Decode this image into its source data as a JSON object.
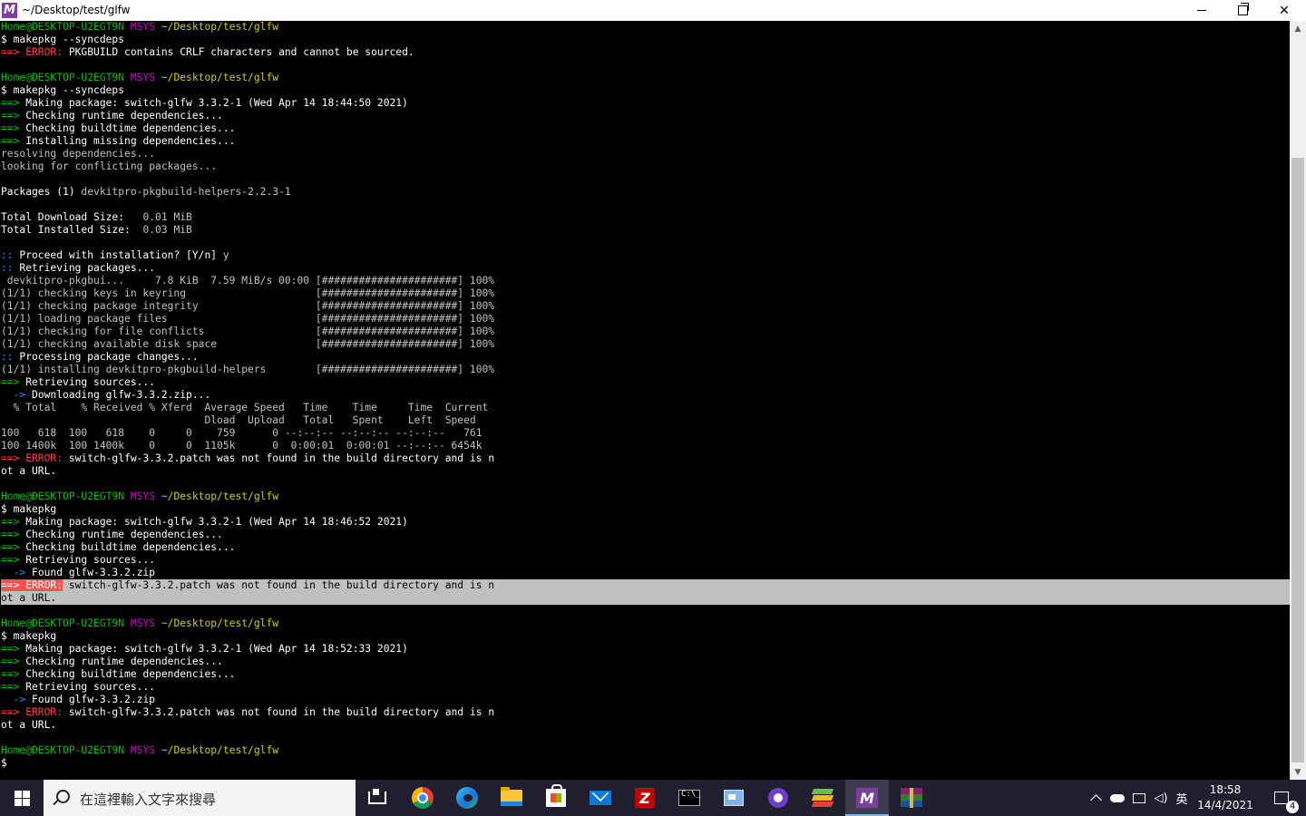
{
  "window": {
    "title": "~/Desktop/test/glfw",
    "app_icon_letter": "M",
    "minimize_icon": "minimize-icon",
    "maximize_icon": "restore-icon",
    "close_symbol": "✕"
  },
  "terminal": {
    "lines": [
      {
        "segs": [
          {
            "t": "Home@DESKTOP-U2EGT9N ",
            "c": "g"
          },
          {
            "t": "MSYS ",
            "c": "m"
          },
          {
            "t": "~/Desktop/test/glfw",
            "c": "y"
          }
        ]
      },
      {
        "segs": [
          {
            "t": "$ makepkg --syncdeps",
            "c": "w"
          }
        ]
      },
      {
        "segs": [
          {
            "t": "==> ERROR: ",
            "c": "r"
          },
          {
            "t": "PKGBUILD contains CRLF characters and cannot be sourced.",
            "c": "w"
          }
        ]
      },
      {
        "segs": []
      },
      {
        "segs": [
          {
            "t": "Home@DESKTOP-U2EGT9N ",
            "c": "g"
          },
          {
            "t": "MSYS ",
            "c": "m"
          },
          {
            "t": "~/Desktop/test/glfw",
            "c": "y"
          }
        ]
      },
      {
        "segs": [
          {
            "t": "$ makepkg --syncdeps",
            "c": "w"
          }
        ]
      },
      {
        "segs": [
          {
            "t": "==> ",
            "c": "g"
          },
          {
            "t": "Making package: switch-glfw 3.3.2-1 (Wed Apr 14 18:44:50 2021)",
            "c": "w"
          }
        ]
      },
      {
        "segs": [
          {
            "t": "==> ",
            "c": "g"
          },
          {
            "t": "Checking runtime dependencies...",
            "c": "w"
          }
        ]
      },
      {
        "segs": [
          {
            "t": "==> ",
            "c": "g"
          },
          {
            "t": "Checking buildtime dependencies...",
            "c": "w"
          }
        ]
      },
      {
        "segs": [
          {
            "t": "==> ",
            "c": "g"
          },
          {
            "t": "Installing missing dependencies...",
            "c": "w"
          }
        ]
      },
      {
        "segs": [
          {
            "t": "resolving dependencies...",
            "c": "p"
          }
        ]
      },
      {
        "segs": [
          {
            "t": "looking for conflicting packages...",
            "c": "p"
          }
        ]
      },
      {
        "segs": []
      },
      {
        "segs": [
          {
            "t": "Packages (1) ",
            "c": "w"
          },
          {
            "t": "devkitpro-pkgbuild-helpers-2.2.3-1",
            "c": "p"
          }
        ]
      },
      {
        "segs": []
      },
      {
        "segs": [
          {
            "t": "Total Download Size:  ",
            "c": "w"
          },
          {
            "t": " 0.01 MiB",
            "c": "p"
          }
        ]
      },
      {
        "segs": [
          {
            "t": "Total Installed Size: ",
            "c": "w"
          },
          {
            "t": " 0.03 MiB",
            "c": "p"
          }
        ]
      },
      {
        "segs": []
      },
      {
        "segs": [
          {
            "t": ":: ",
            "c": "b"
          },
          {
            "t": "Proceed with installation? [Y/n] ",
            "c": "w"
          },
          {
            "t": "y",
            "c": "p"
          }
        ]
      },
      {
        "segs": [
          {
            "t": ":: ",
            "c": "b"
          },
          {
            "t": "Retrieving packages...",
            "c": "w"
          }
        ]
      },
      {
        "segs": [
          {
            "t": " devkitpro-pkgbui...     7.8 KiB  7.59 MiB/s 00:00 [######################] 100%",
            "c": "p"
          }
        ]
      },
      {
        "segs": [
          {
            "t": "(1/1) checking keys in keyring                     [######################] 100%",
            "c": "p"
          }
        ]
      },
      {
        "segs": [
          {
            "t": "(1/1) checking package integrity                   [######################] 100%",
            "c": "p"
          }
        ]
      },
      {
        "segs": [
          {
            "t": "(1/1) loading package files                        [######################] 100%",
            "c": "p"
          }
        ]
      },
      {
        "segs": [
          {
            "t": "(1/1) checking for file conflicts                  [######################] 100%",
            "c": "p"
          }
        ]
      },
      {
        "segs": [
          {
            "t": "(1/1) checking available disk space                [######################] 100%",
            "c": "p"
          }
        ]
      },
      {
        "segs": [
          {
            "t": ":: ",
            "c": "b"
          },
          {
            "t": "Processing package changes...",
            "c": "w"
          }
        ]
      },
      {
        "segs": [
          {
            "t": "(1/1) installing devkitpro-pkgbuild-helpers        [######################] 100%",
            "c": "p"
          }
        ]
      },
      {
        "segs": [
          {
            "t": "==> ",
            "c": "g"
          },
          {
            "t": "Retrieving sources...",
            "c": "w"
          }
        ]
      },
      {
        "segs": [
          {
            "t": "  -> ",
            "c": "b"
          },
          {
            "t": "Downloading glfw-3.3.2.zip...",
            "c": "w"
          }
        ]
      },
      {
        "segs": [
          {
            "t": "  % Total    % Received % Xferd  Average Speed   Time    Time     Time  Current",
            "c": "p"
          }
        ]
      },
      {
        "segs": [
          {
            "t": "                                 Dload  Upload   Total   Spent    Left  Speed",
            "c": "p"
          }
        ]
      },
      {
        "segs": [
          {
            "t": "100   618  100   618    0     0    759      0 --:--:-- --:--:-- --:--:--   761",
            "c": "p"
          }
        ]
      },
      {
        "segs": [
          {
            "t": "100 1400k  100 1400k    0     0  1105k      0  0:00:01  0:00:01 --:--:-- 6454k",
            "c": "p"
          }
        ]
      },
      {
        "segs": [
          {
            "t": "==> ERROR: ",
            "c": "r"
          },
          {
            "t": "switch-glfw-3.3.2.patch was not found in the build directory and is n",
            "c": "w"
          }
        ]
      },
      {
        "segs": [
          {
            "t": "ot a URL.",
            "c": "w"
          }
        ]
      },
      {
        "segs": []
      },
      {
        "segs": [
          {
            "t": "Home@DESKTOP-U2EGT9N ",
            "c": "g"
          },
          {
            "t": "MSYS ",
            "c": "m"
          },
          {
            "t": "~/Desktop/test/glfw",
            "c": "y"
          }
        ]
      },
      {
        "segs": [
          {
            "t": "$ makepkg",
            "c": "w"
          }
        ]
      },
      {
        "segs": [
          {
            "t": "==> ",
            "c": "g"
          },
          {
            "t": "Making package: switch-glfw 3.3.2-1 (Wed Apr 14 18:46:52 2021)",
            "c": "w"
          }
        ]
      },
      {
        "segs": [
          {
            "t": "==> ",
            "c": "g"
          },
          {
            "t": "Checking runtime dependencies...",
            "c": "w"
          }
        ]
      },
      {
        "segs": [
          {
            "t": "==> ",
            "c": "g"
          },
          {
            "t": "Checking buildtime dependencies...",
            "c": "w"
          }
        ]
      },
      {
        "segs": [
          {
            "t": "==> ",
            "c": "g"
          },
          {
            "t": "Retrieving sources...",
            "c": "w"
          }
        ]
      },
      {
        "segs": [
          {
            "t": "  -> ",
            "c": "b"
          },
          {
            "t": "Found glfw-3.3.2.zip",
            "c": "w"
          }
        ]
      },
      {
        "hl": true,
        "segs": [
          {
            "t": "==> ERROR:",
            "c": "r"
          },
          {
            "t": " switch-glfw-3.3.2.patch was not found in the build directory and is n",
            "c": "p"
          }
        ]
      },
      {
        "hl": true,
        "segs": [
          {
            "t": "ot a URL.",
            "c": "p"
          }
        ]
      },
      {
        "segs": []
      },
      {
        "segs": [
          {
            "t": "Home@DESKTOP-U2EGT9N ",
            "c": "g"
          },
          {
            "t": "MSYS ",
            "c": "m"
          },
          {
            "t": "~/Desktop/test/glfw",
            "c": "y"
          }
        ]
      },
      {
        "segs": [
          {
            "t": "$ makepkg",
            "c": "w"
          }
        ]
      },
      {
        "segs": [
          {
            "t": "==> ",
            "c": "g"
          },
          {
            "t": "Making package: switch-glfw 3.3.2-1 (Wed Apr 14 18:52:33 2021)",
            "c": "w"
          }
        ]
      },
      {
        "segs": [
          {
            "t": "==> ",
            "c": "g"
          },
          {
            "t": "Checking runtime dependencies...",
            "c": "w"
          }
        ]
      },
      {
        "segs": [
          {
            "t": "==> ",
            "c": "g"
          },
          {
            "t": "Checking buildtime dependencies...",
            "c": "w"
          }
        ]
      },
      {
        "segs": [
          {
            "t": "==> ",
            "c": "g"
          },
          {
            "t": "Retrieving sources...",
            "c": "w"
          }
        ]
      },
      {
        "segs": [
          {
            "t": "  -> ",
            "c": "b"
          },
          {
            "t": "Found glfw-3.3.2.zip",
            "c": "w"
          }
        ]
      },
      {
        "segs": [
          {
            "t": "==> ERROR: ",
            "c": "r"
          },
          {
            "t": "switch-glfw-3.3.2.patch was not found in the build directory and is n",
            "c": "w"
          }
        ]
      },
      {
        "segs": [
          {
            "t": "ot a URL.",
            "c": "w"
          }
        ]
      },
      {
        "segs": []
      },
      {
        "segs": [
          {
            "t": "Home@DESKTOP-U2EGT9N ",
            "c": "g"
          },
          {
            "t": "MSYS ",
            "c": "m"
          },
          {
            "t": "~/Desktop/test/glfw",
            "c": "y"
          }
        ]
      },
      {
        "segs": [
          {
            "t": "$",
            "c": "w"
          }
        ]
      }
    ]
  },
  "scrollbar": {
    "up_arrow": "▲",
    "down_arrow": "▼"
  },
  "taskbar": {
    "search_placeholder": "在這裡輸入文字來搜尋",
    "pinned": [
      {
        "name": "task-view-icon"
      },
      {
        "name": "chrome-icon"
      },
      {
        "name": "edge-icon"
      },
      {
        "name": "file-explorer-icon"
      },
      {
        "name": "microsoft-store-icon"
      },
      {
        "name": "mail-icon"
      },
      {
        "name": "filezilla-icon",
        "letter": "Z"
      },
      {
        "name": "command-prompt-icon",
        "text": "C:\\_"
      },
      {
        "name": "control-panel-icon"
      },
      {
        "name": "github-desktop-icon"
      },
      {
        "name": "bluestacks-icon"
      },
      {
        "name": "msys2-icon",
        "letter": "M"
      },
      {
        "name": "winrar-icon"
      }
    ],
    "tray": {
      "ime": "英",
      "time": "18:58",
      "date": "14/4/2021",
      "notification_count": "4"
    }
  }
}
